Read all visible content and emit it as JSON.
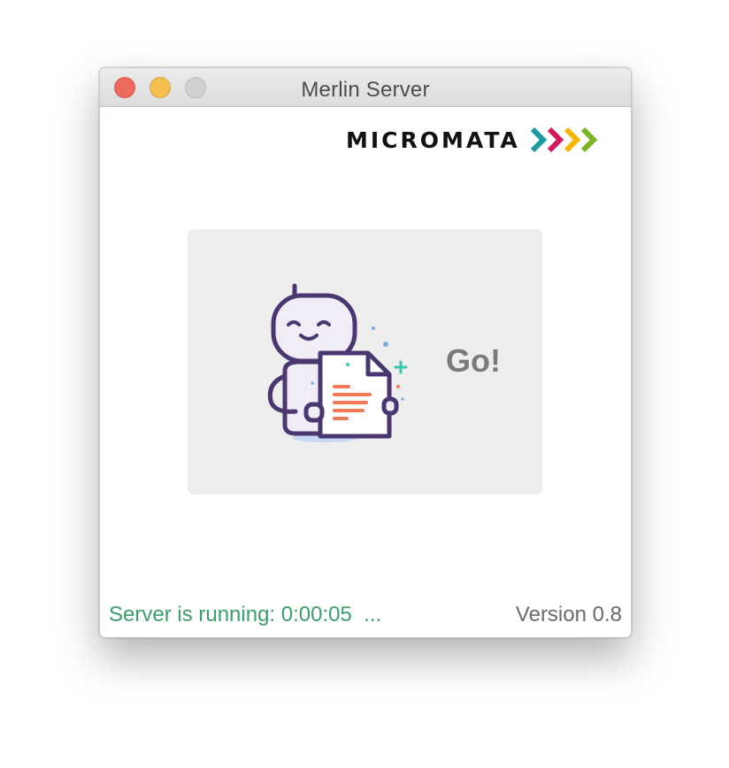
{
  "window": {
    "title": "Merlin Server"
  },
  "titlebar": {
    "buttons": {
      "close_icon": "close-traffic-light",
      "minimize_icon": "minimize-traffic-light",
      "zoom_icon": "zoom-traffic-light"
    }
  },
  "brand": {
    "wordmark": "MICROMATA",
    "chevron_colors": [
      "#1b9aa0",
      "#d6195e",
      "#f7b500",
      "#7bb520"
    ]
  },
  "main": {
    "go_label": "Go!",
    "illustration_icon": "robot-holding-document-icon"
  },
  "status": {
    "text": "Server is running: 0:00:05  ...",
    "color": "#3c9f6a"
  },
  "version": {
    "text": "Version 0.8"
  }
}
